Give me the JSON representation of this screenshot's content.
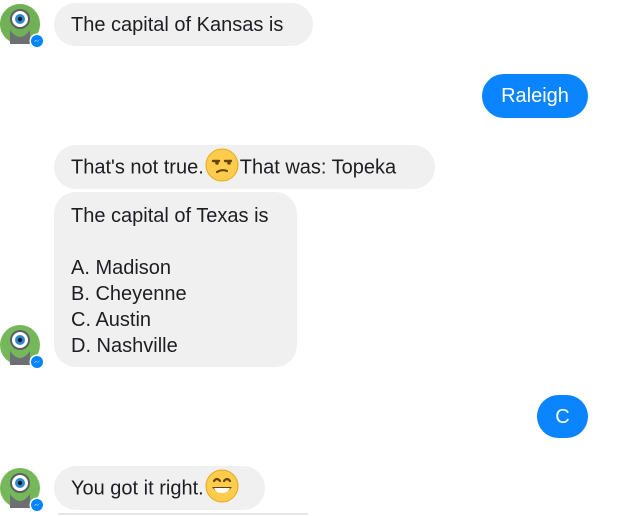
{
  "icons": {
    "avatar": "bot-avatar-icon",
    "messenger_badge": "messenger-badge-icon",
    "unamused": "unamused-face-emoji-icon",
    "grin": "grinning-face-emoji-icon"
  },
  "colors": {
    "incoming_bg": "#f1f0f0",
    "outgoing_bg": "#0b84ff",
    "messenger_blue": "#0084ff"
  },
  "messages": {
    "m1": {
      "text": "The capital of Kansas is"
    },
    "m2": {
      "text": "Raleigh"
    },
    "m3": {
      "part1": "That's not true.",
      "part2": "That was: Topeka"
    },
    "m4": {
      "question": "The capital of Texas is",
      "options": [
        "A. Madison",
        "B. Cheyenne",
        "C. Austin",
        "D. Nashville"
      ]
    },
    "m5": {
      "text": "C"
    },
    "m6": {
      "text": "You got it right."
    }
  }
}
